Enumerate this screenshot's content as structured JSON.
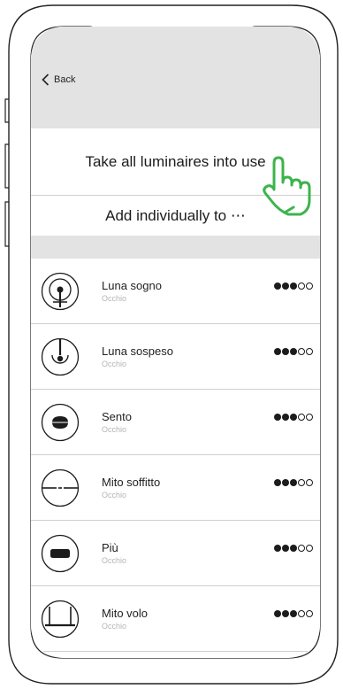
{
  "nav": {
    "back_label": "Back"
  },
  "actions": {
    "take_all": "Take all luminaires into use",
    "add_individually": "Add individually to ⋯"
  },
  "luminaires": [
    {
      "name": "Luna sogno",
      "subtitle": "Occhio",
      "icon": "luna-sogno-icon",
      "signal": 3,
      "signal_max": 5
    },
    {
      "name": "Luna sospeso",
      "subtitle": "Occhio",
      "icon": "luna-sospeso-icon",
      "signal": 3,
      "signal_max": 5
    },
    {
      "name": "Sento",
      "subtitle": "Occhio",
      "icon": "sento-icon",
      "signal": 3,
      "signal_max": 5
    },
    {
      "name": "Mito soffitto",
      "subtitle": "Occhio",
      "icon": "mito-soffitto-icon",
      "signal": 3,
      "signal_max": 5
    },
    {
      "name": "Più",
      "subtitle": "Occhio",
      "icon": "piu-icon",
      "signal": 3,
      "signal_max": 5
    },
    {
      "name": "Mito volo",
      "subtitle": "Occhio",
      "icon": "mito-volo-icon",
      "signal": 3,
      "signal_max": 5
    }
  ],
  "colors": {
    "header_gray": "#e3e3e3",
    "hand_green": "#3cb44b",
    "text": "#1c1c1c",
    "subtext": "#b5b5b5"
  }
}
